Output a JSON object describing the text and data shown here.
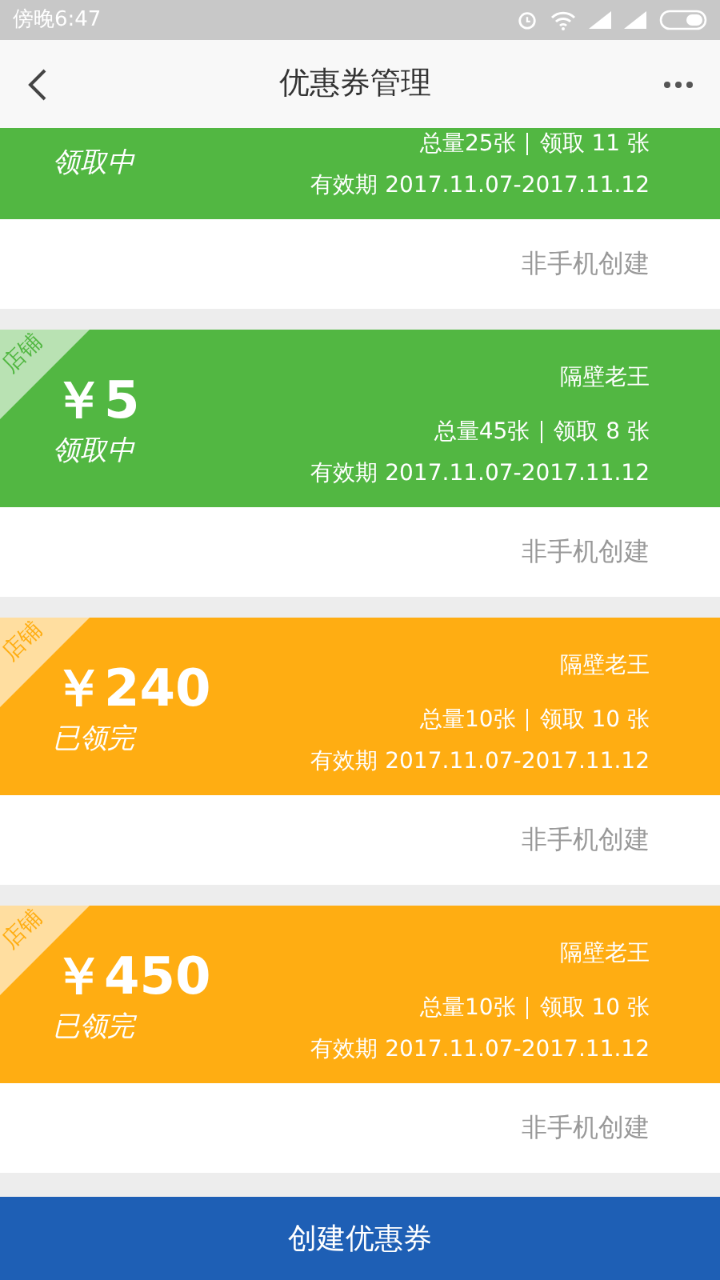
{
  "status_bar": {
    "time": "傍晚6:47"
  },
  "header": {
    "title": "优惠券管理"
  },
  "coupons": [
    {
      "color": "#52b742",
      "status": "领取中",
      "total": "总量25张",
      "claimed": "领取 11 张",
      "validity": "有效期 2017.11.07-2017.11.12",
      "source": "非手机创建"
    },
    {
      "color": "#52b742",
      "tag": "店铺",
      "price": "￥5",
      "status": "领取中",
      "shop": "隔壁老王",
      "total": "总量45张",
      "claimed": "领取 8 张",
      "validity": "有效期 2017.11.07-2017.11.12",
      "source": "非手机创建"
    },
    {
      "color": "#ffad12",
      "tag": "店铺",
      "price": "￥240",
      "status": "已领完",
      "shop": "隔壁老王",
      "total": "总量10张",
      "claimed": "领取 10 张",
      "validity": "有效期 2017.11.07-2017.11.12",
      "source": "非手机创建"
    },
    {
      "color": "#ffad12",
      "tag": "店铺",
      "price": "￥450",
      "status": "已领完",
      "shop": "隔壁老王",
      "total": "总量10张",
      "claimed": "领取 10 张",
      "validity": "有效期 2017.11.07-2017.11.12",
      "source": "非手机创建"
    }
  ],
  "create_button": "创建优惠券"
}
